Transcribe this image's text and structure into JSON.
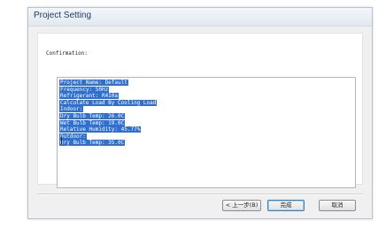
{
  "window": {
    "title": "Project Setting"
  },
  "confirmation": {
    "label": "Confirmation:",
    "lines": [
      "Project Name: Default",
      "Frequency: 50Hz",
      "Refrigerant: R410a",
      "Calculate Load By Cooling Load",
      "Indoor:",
      "Dry Bulb Temp: 26.0C",
      "Wet Bulb Temp: 19.0C",
      "Relative Humidity: 45.77%",
      "Outdoor:",
      "Dry Bulb Temp: 35.0C"
    ]
  },
  "buttons": {
    "back": "< 上一步(B)",
    "finish": "完成",
    "cancel": "取消"
  }
}
